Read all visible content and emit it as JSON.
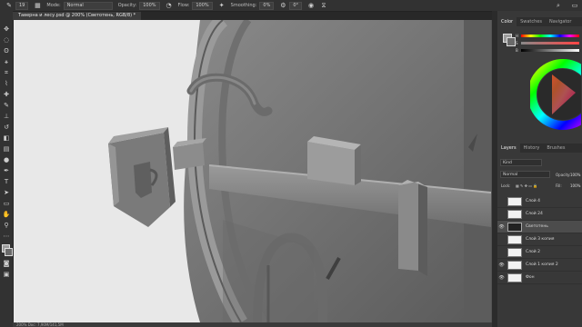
{
  "options_bar": {
    "brush_size": "19",
    "mode_label": "Mode:",
    "mode_value": "Normal",
    "opacity_label": "Opacity:",
    "opacity_value": "100%",
    "flow_label": "Flow:",
    "flow_value": "100%",
    "smoothing_label": "Smoothing:",
    "smoothing_value": "0%",
    "angle_value": "0°"
  },
  "document_tab": {
    "title": "Таверна и лесу.psd @ 200% (Светотень, RGB/8) *"
  },
  "status": {
    "text": "200%   Doc: 7,90M/141,5M"
  },
  "color_panel": {
    "tabs": [
      "Color",
      "Swatches",
      "Navigator"
    ],
    "active_tab": "Color"
  },
  "layers_panel": {
    "tabs": [
      "Layers",
      "History",
      "Brushes"
    ],
    "active_tab": "Layers",
    "kind_label": "Kind",
    "blend_mode": "Normal",
    "opacity_label": "Opacity:",
    "opacity_value": "100%",
    "lock_label": "Lock:",
    "fill_label": "Fill:",
    "fill_value": "100%",
    "layers": [
      {
        "name": "Слой 4",
        "visible": false,
        "selected": false
      },
      {
        "name": "Слой 24",
        "visible": false,
        "selected": false
      },
      {
        "name": "Светотень",
        "visible": true,
        "selected": true
      },
      {
        "name": "Слой 3 копия",
        "visible": false,
        "selected": false
      },
      {
        "name": "Слой 2",
        "visible": false,
        "selected": false
      },
      {
        "name": "Слой 1 копия 2",
        "visible": true,
        "selected": false
      },
      {
        "name": "Фон",
        "visible": true,
        "selected": false
      }
    ]
  },
  "colors": {
    "app_background": "#535353",
    "panel": "#383838",
    "canvas_paper": "#e6e6e6",
    "model_gray": "#7a7a7a"
  }
}
